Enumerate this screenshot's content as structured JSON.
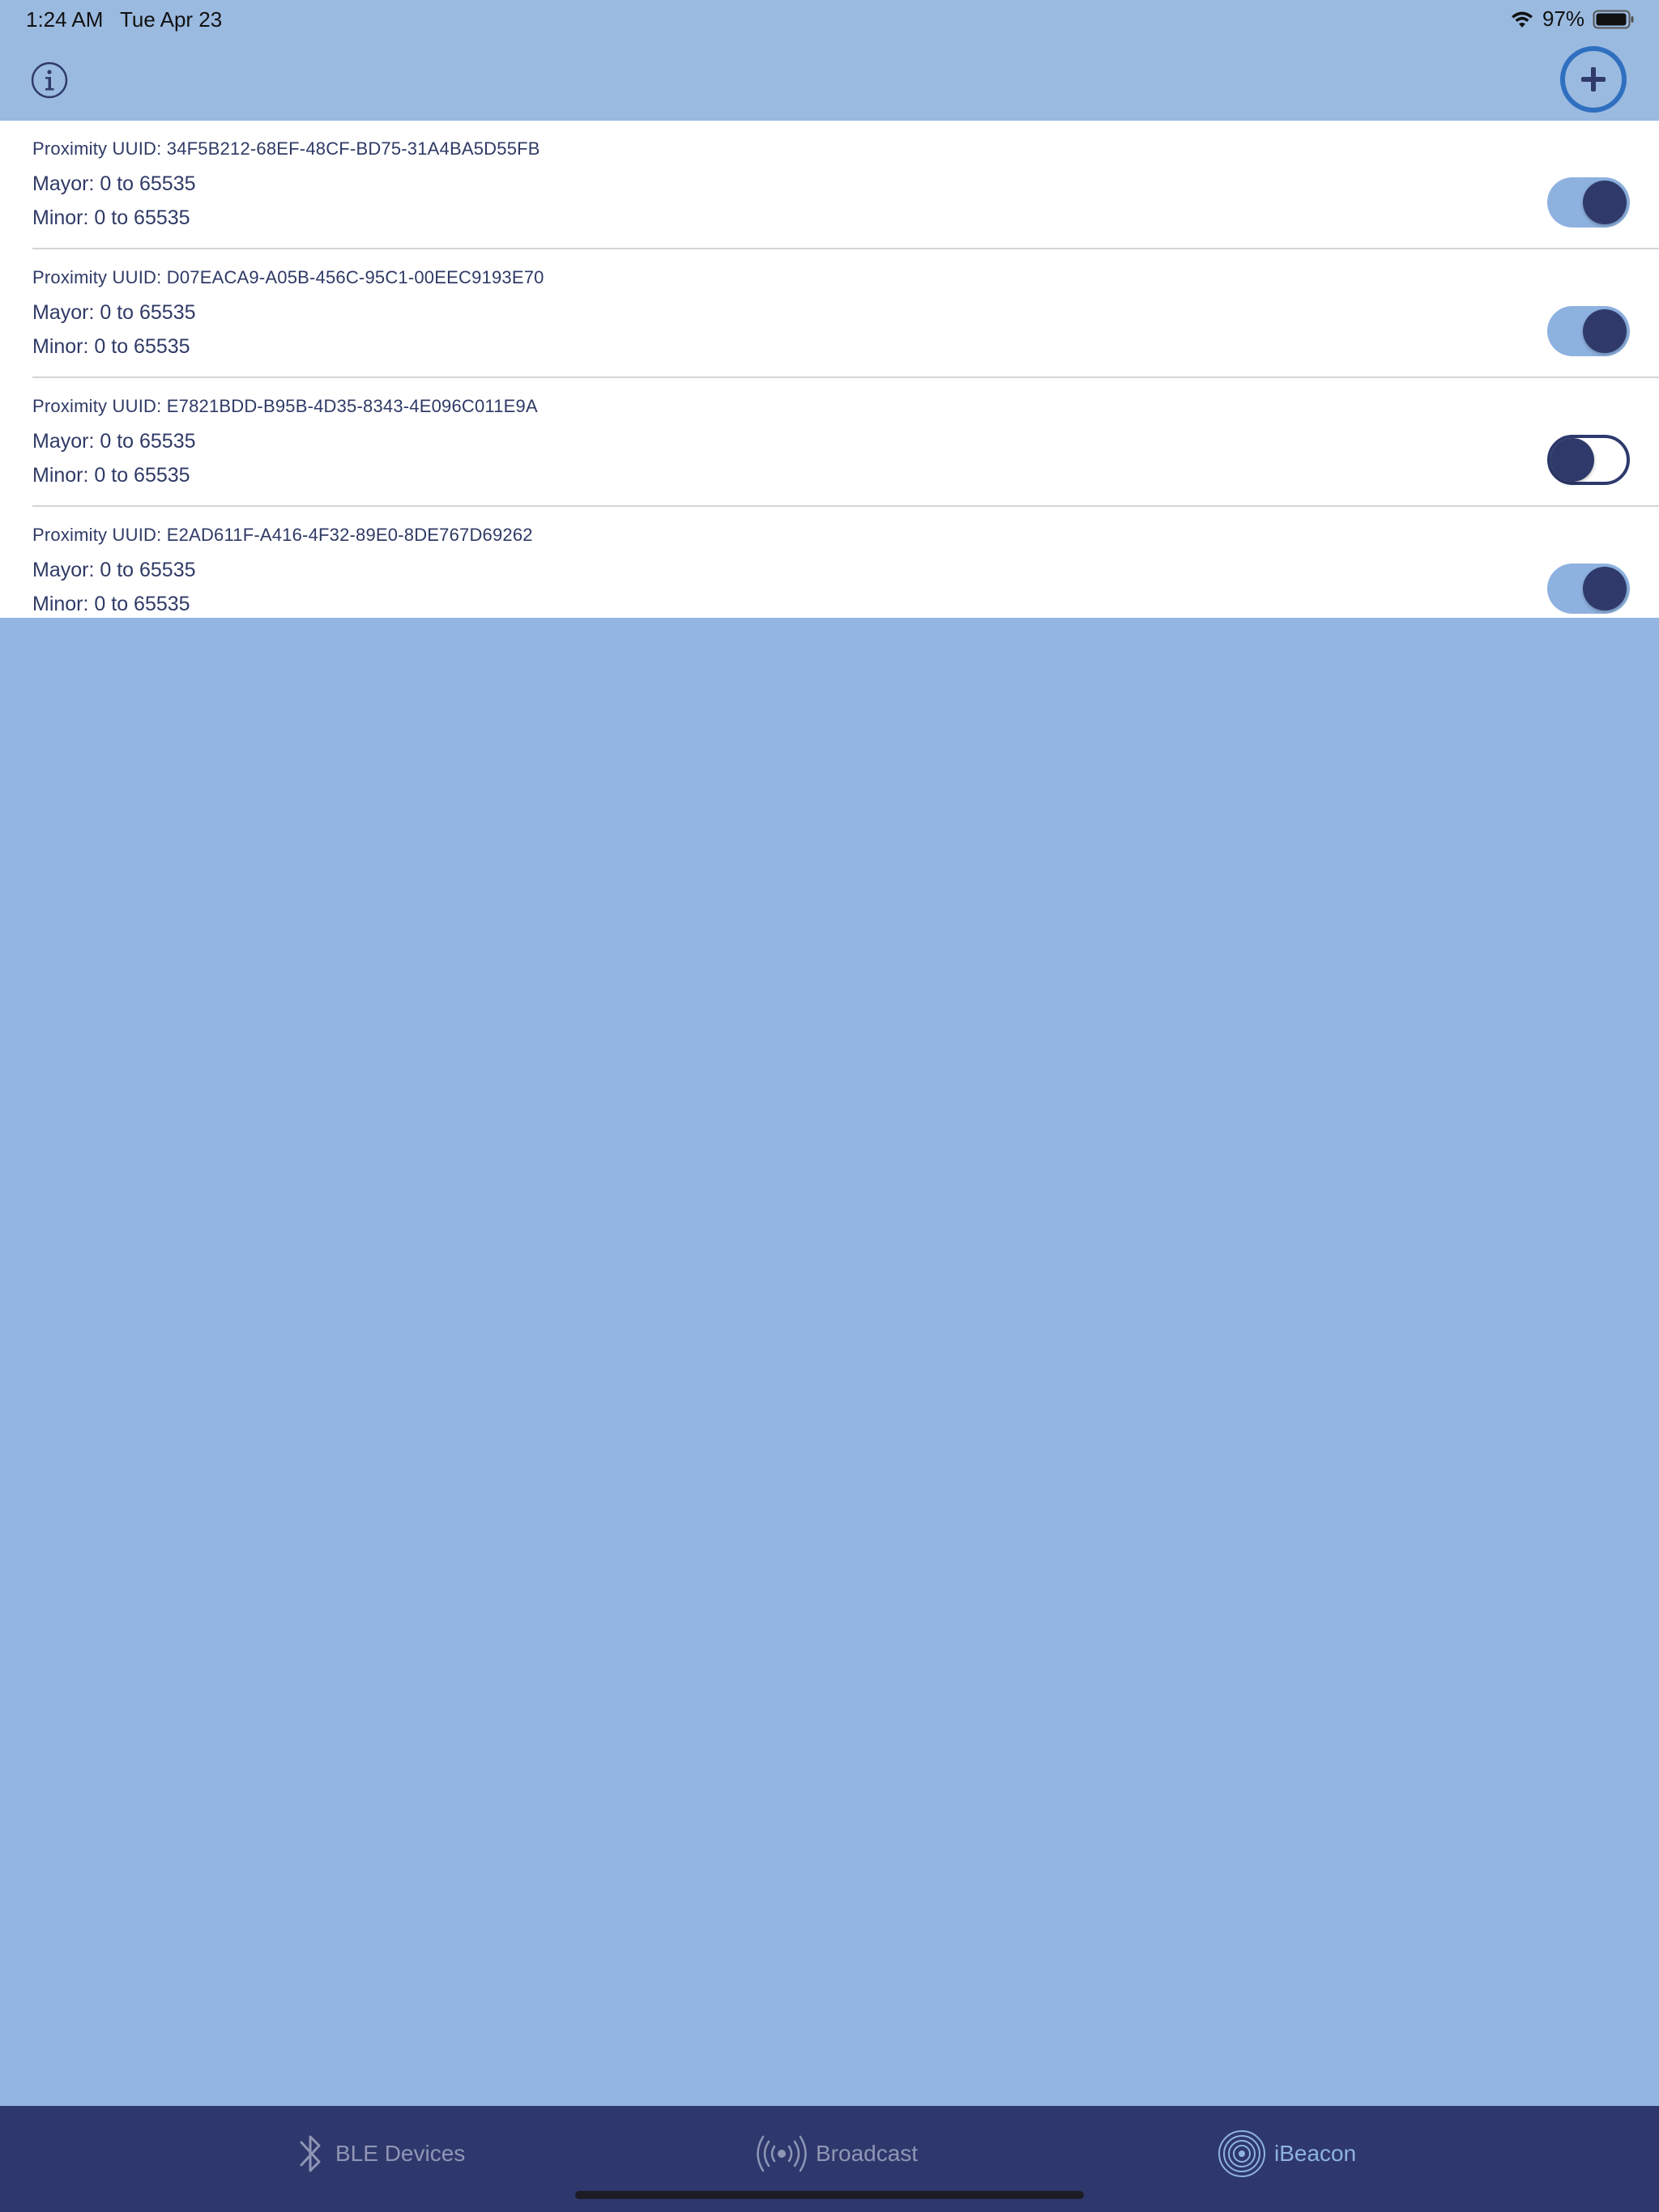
{
  "status_bar": {
    "time": "1:24 AM",
    "date": "Tue Apr 23",
    "battery_percent": "97%",
    "icons": [
      "wifi-icon",
      "battery-icon"
    ]
  },
  "header": {
    "info_icon": "info-icon",
    "add_icon": "plus-circle-icon"
  },
  "beacons": [
    {
      "uuid": "Proximity UUID: 34F5B212-68EF-48CF-BD75-31A4BA5D55FB",
      "mayor": "Mayor: 0 to 65535",
      "minor": "Minor: 0 to 65535",
      "enabled": true
    },
    {
      "uuid": "Proximity UUID: D07EACA9-A05B-456C-95C1-00EEC9193E70",
      "mayor": "Mayor: 0 to 65535",
      "minor": "Minor: 0 to 65535",
      "enabled": true
    },
    {
      "uuid": "Proximity UUID: E7821BDD-B95B-4D35-8343-4E096C011E9A",
      "mayor": "Mayor: 0 to 65535",
      "minor": "Minor: 0 to 65535",
      "enabled": false
    },
    {
      "uuid": "Proximity UUID: E2AD611F-A416-4F32-89E0-8DE767D69262",
      "mayor": "Mayor: 0 to 65535",
      "minor": "Minor: 0 to 65535",
      "enabled": true
    }
  ],
  "tabs": [
    {
      "label": "BLE Devices",
      "icon": "bluetooth-icon",
      "active": false
    },
    {
      "label": "Broadcast",
      "icon": "broadcast-icon",
      "active": false
    },
    {
      "label": "iBeacon",
      "icon": "ibeacon-icon",
      "active": true
    }
  ],
  "colors": {
    "header_bg": "#9bbae0",
    "page_bg": "#92b5e2",
    "tabbar_bg": "#2e386c",
    "accent_dark": "#2f3a6b",
    "toggle_on_track": "#8eb2e0",
    "add_ring": "#2f6fbf"
  }
}
